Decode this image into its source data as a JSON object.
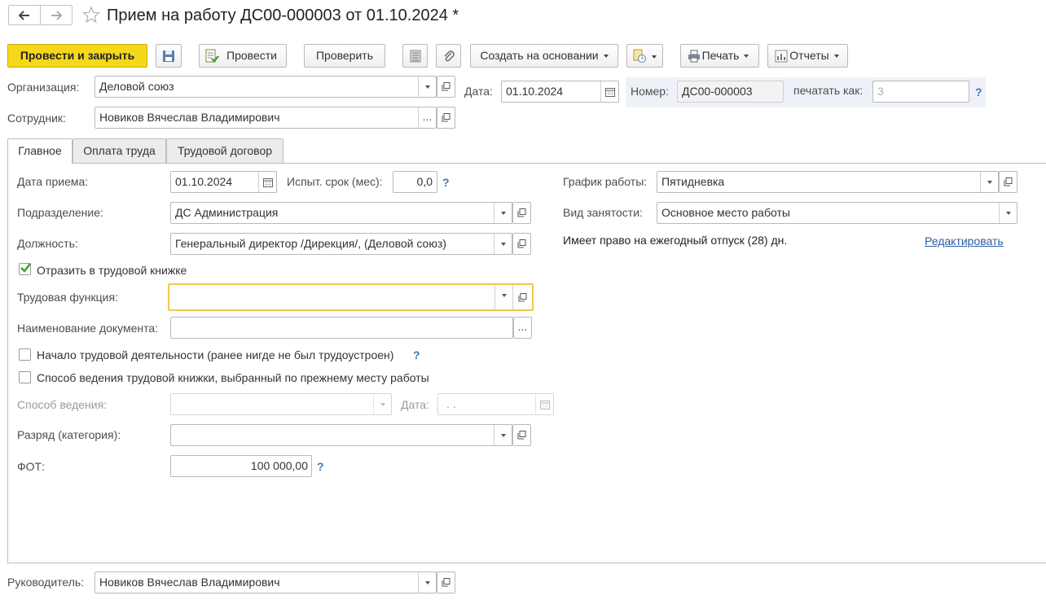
{
  "window": {
    "title": "Прием на работу ДС00-000003 от 01.10.2024 *"
  },
  "toolbar": {
    "post_close": "Провести и закрыть",
    "post": "Провести",
    "check": "Проверить",
    "create_based": "Создать на основании",
    "print": "Печать",
    "reports": "Отчеты"
  },
  "header": {
    "org_label": "Организация:",
    "org_value": "Деловой союз",
    "date_label": "Дата:",
    "date_value": "01.10.2024",
    "number_label": "Номер:",
    "number_value": "ДС00-000003",
    "print_as_label": "печатать как:",
    "print_as_placeholder": "3",
    "help": "?",
    "employee_label": "Сотрудник:",
    "employee_value": "Новиков Вячеслав Владимирович",
    "more": "..."
  },
  "tabs": [
    {
      "label": "Главное",
      "active": true
    },
    {
      "label": "Оплата труда",
      "active": false
    },
    {
      "label": "Трудовой договор",
      "active": false
    }
  ],
  "main": {
    "hire_date_label": "Дата приема:",
    "hire_date_value": "01.10.2024",
    "probation_label": "Испыт. срок (мес):",
    "probation_value": "0,0",
    "department_label": "Подразделение:",
    "department_value": "ДС Администрация",
    "position_label": "Должность:",
    "position_value": "Генеральный директор /Дирекция/, (Деловой союз)",
    "reflect_checkbox": "Отразить в трудовой книжке",
    "reflect_checked": true,
    "labor_function_label": "Трудовая функция:",
    "labor_function_value": "",
    "doc_name_label": "Наименование документа:",
    "doc_name_value": "",
    "start_work_checkbox": "Начало трудовой деятельности (ранее нигде не был трудоустроен)",
    "start_work_checked": false,
    "method_prev_checkbox": "Способ ведения трудовой книжки, выбранный по прежнему месту работы",
    "method_prev_checked": false,
    "method_label": "Способ ведения:",
    "method_date_label": "Дата:",
    "method_date_value": " .  .",
    "grade_label": "Разряд (категория):",
    "grade_value": "",
    "fot_label": "ФОТ:",
    "fot_value": "100 000,00",
    "schedule_label": "График работы:",
    "schedule_value": "Пятидневка",
    "employment_label": "Вид занятости:",
    "employment_value": "Основное место работы",
    "vacation_text": "Имеет право на ежегодный отпуск (28) дн.",
    "edit_link": "Редактировать"
  },
  "footer": {
    "manager_label": "Руководитель:",
    "manager_value": "Новиков Вячеслав Владимирович"
  },
  "colors": {
    "primary_button": "#f5d81a",
    "help": "#3f76b8",
    "link": "#2b5ea7",
    "focus": "#f0c94a"
  }
}
